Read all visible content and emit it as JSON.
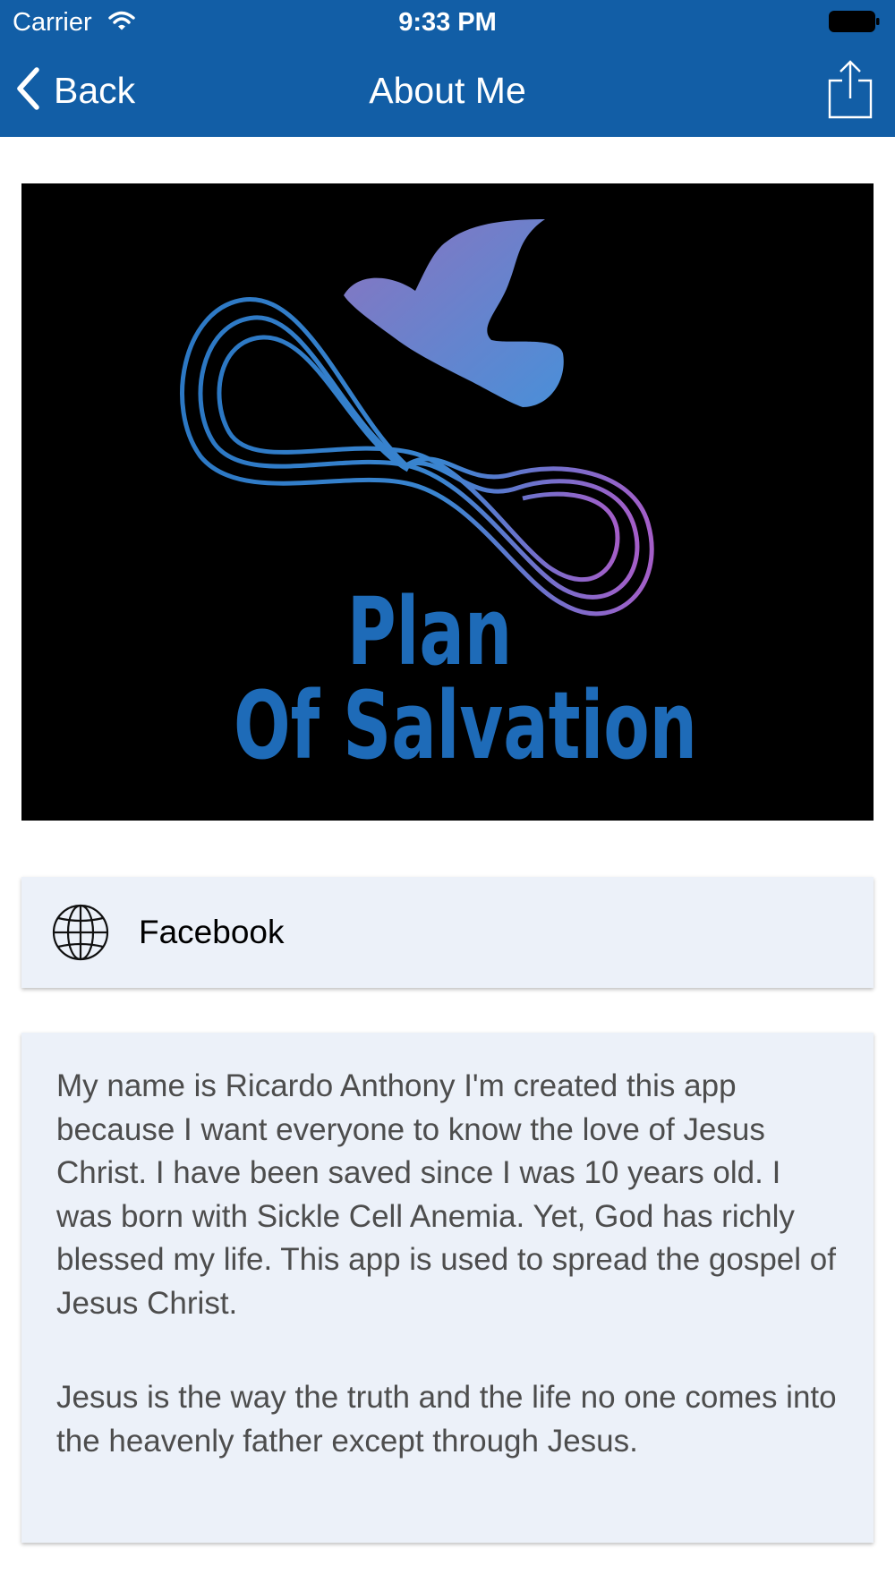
{
  "status_bar": {
    "carrier": "Carrier",
    "time": "9:33 PM"
  },
  "nav": {
    "back_label": "Back",
    "title": "About Me"
  },
  "banner": {
    "line1": "Plan",
    "line2": "Of Salvation"
  },
  "links": [
    {
      "label": "Facebook",
      "icon": "globe-icon"
    }
  ],
  "about": {
    "paragraph1": "My name is Ricardo Anthony I'm created this app because I want everyone to know the love of Jesus Christ. I have been saved since I was 10 years old. I was born with Sickle Cell Anemia. Yet, God has richly blessed my life. This app is used to spread the gospel of Jesus Christ.",
    "paragraph2": "Jesus is the way the truth and the life no one comes into the heavenly father except through Jesus."
  },
  "colors": {
    "header": "#125ea6",
    "card_background": "#ecf1f9",
    "banner_text": "#1e6bb8"
  }
}
